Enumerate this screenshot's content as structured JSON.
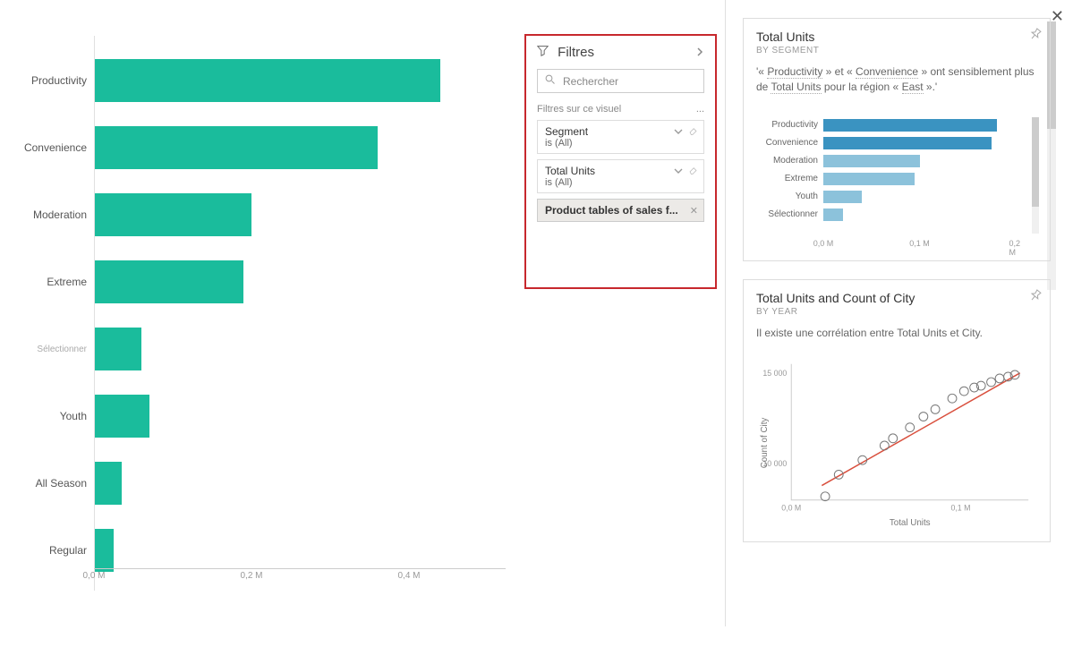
{
  "main_chart": {
    "categories": [
      "Productivity",
      "Convenience",
      "Moderation",
      "Extreme",
      "Sélectionner",
      "Youth",
      "All Season",
      "Regular"
    ],
    "label_small_idx": 4,
    "values": [
      0.44,
      0.36,
      0.2,
      0.19,
      0.06,
      0.07,
      0.035,
      0.025
    ],
    "xticks": [
      {
        "v": 0,
        "label": "0,0 M"
      },
      {
        "v": 0.2,
        "label": "0,2 M"
      },
      {
        "v": 0.4,
        "label": "0,4 M"
      }
    ],
    "xmax": 0.5,
    "bar_color": "#1abc9c"
  },
  "filters": {
    "title": "Filtres",
    "search_placeholder": "Rechercher",
    "section_label": "Filtres sur ce visuel",
    "ellipsis": "...",
    "cards": [
      {
        "name": "Segment",
        "val": "is (All)",
        "icons": [
          "chevron",
          "eraser"
        ]
      },
      {
        "name": "Total Units",
        "val": "is (All)",
        "icons": [
          "chevron",
          "eraser"
        ]
      },
      {
        "name": "Product tables of sales f...",
        "val": "",
        "icons": [
          "close"
        ],
        "active": true
      }
    ]
  },
  "card1": {
    "title": "Total Units",
    "subtitle": "BY SEGMENT",
    "insight_pre": "'« ",
    "insight_hl1": "Productivity",
    "insight_mid1": " » et « ",
    "insight_hl2": "Convenience",
    "insight_mid2": " » ont sensiblement plus de ",
    "insight_hl3": "Total Units",
    "insight_mid3": " pour la région « ",
    "insight_hl4": "East",
    "insight_end": " ».'"
  },
  "small_chart": {
    "categories": [
      "Productivity",
      "Convenience",
      "Moderation",
      "Extreme",
      "Youth",
      "Sélectionner"
    ],
    "values": [
      0.18,
      0.175,
      0.1,
      0.095,
      0.04,
      0.02
    ],
    "colors": [
      "#3a93c1",
      "#3a93c1",
      "#8cc2db",
      "#8cc2db",
      "#8cc2db",
      "#8cc2db"
    ],
    "xticks": [
      {
        "v": 0,
        "label": "0,0 M"
      },
      {
        "v": 0.1,
        "label": "0,1 M"
      },
      {
        "v": 0.2,
        "label": "0,2 M"
      }
    ],
    "xmax": 0.2
  },
  "card2": {
    "title": "Total Units and Count of City",
    "subtitle": "BY YEAR",
    "insight": "Il existe une corrélation entre Total Units et City.",
    "xlabel": "Total Units",
    "ylabel": "Count of City",
    "xticks": [
      "0,0 M",
      "0,1 M"
    ],
    "yticks": [
      "10 000",
      "15 000"
    ]
  },
  "scatter_points": [
    {
      "x": 0.02,
      "y": 8200
    },
    {
      "x": 0.028,
      "y": 9400
    },
    {
      "x": 0.042,
      "y": 10200
    },
    {
      "x": 0.055,
      "y": 11000
    },
    {
      "x": 0.06,
      "y": 11400
    },
    {
      "x": 0.07,
      "y": 12000
    },
    {
      "x": 0.078,
      "y": 12600
    },
    {
      "x": 0.085,
      "y": 13000
    },
    {
      "x": 0.095,
      "y": 13600
    },
    {
      "x": 0.102,
      "y": 14000
    },
    {
      "x": 0.108,
      "y": 14200
    },
    {
      "x": 0.112,
      "y": 14300
    },
    {
      "x": 0.118,
      "y": 14500
    },
    {
      "x": 0.123,
      "y": 14700
    },
    {
      "x": 0.128,
      "y": 14800
    },
    {
      "x": 0.132,
      "y": 14900
    }
  ],
  "chart_data": [
    {
      "type": "bar",
      "orientation": "horizontal",
      "title": "",
      "categories": [
        "Productivity",
        "Convenience",
        "Moderation",
        "Extreme",
        "Sélectionner",
        "Youth",
        "All Season",
        "Regular"
      ],
      "values": [
        0.44,
        0.36,
        0.2,
        0.19,
        0.06,
        0.07,
        0.035,
        0.025
      ],
      "xlabel": "",
      "ylabel": "",
      "xticks": [
        "0,0 M",
        "0,2 M",
        "0,4 M"
      ],
      "xlim": [
        0,
        0.5
      ]
    },
    {
      "type": "bar",
      "orientation": "horizontal",
      "title": "Total Units by Segment",
      "categories": [
        "Productivity",
        "Convenience",
        "Moderation",
        "Extreme",
        "Youth",
        "Sélectionner"
      ],
      "values": [
        0.18,
        0.175,
        0.1,
        0.095,
        0.04,
        0.02
      ],
      "xticks": [
        "0,0 M",
        "0,1 M",
        "0,2 M"
      ],
      "xlim": [
        0,
        0.2
      ]
    },
    {
      "type": "scatter",
      "title": "Total Units and Count of City by Year",
      "xlabel": "Total Units",
      "ylabel": "Count of City",
      "x": [
        0.02,
        0.028,
        0.042,
        0.055,
        0.06,
        0.07,
        0.078,
        0.085,
        0.095,
        0.102,
        0.108,
        0.112,
        0.118,
        0.123,
        0.128,
        0.132
      ],
      "y": [
        8200,
        9400,
        10200,
        11000,
        11400,
        12000,
        12600,
        13000,
        13600,
        14000,
        14200,
        14300,
        14500,
        14700,
        14800,
        14900
      ],
      "trendline": true,
      "xlim": [
        0,
        0.14
      ],
      "ylim": [
        8000,
        15500
      ],
      "xticks": [
        "0,0 M",
        "0,1 M"
      ],
      "yticks": [
        "10 000",
        "15 000"
      ]
    }
  ]
}
